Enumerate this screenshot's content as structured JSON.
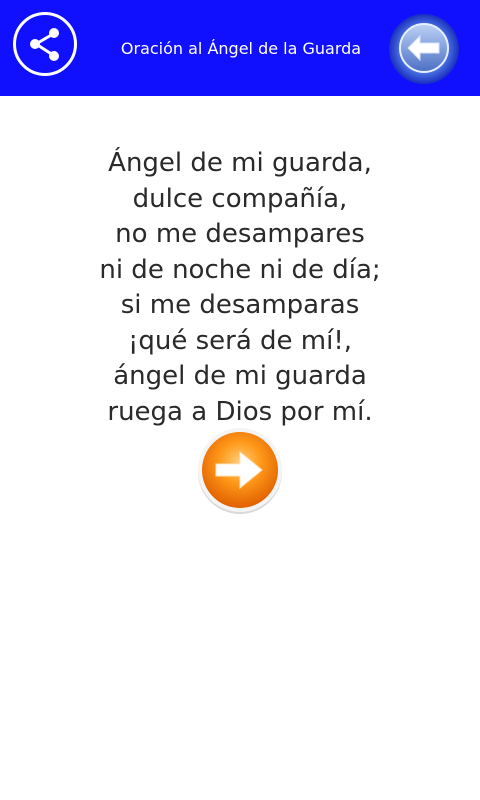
{
  "header": {
    "title": "Oración al Ángel de la Guarda",
    "background_color": "#1010ff",
    "share_icon": "share-icon",
    "back_icon": "arrow-left-icon"
  },
  "prayer": {
    "lines": [
      "Ángel de mi guarda,",
      "dulce compañía,",
      "no me desampares",
      "ni de noche ni de día;",
      "si me desamparas",
      "¡qué será de mí!,",
      "ángel de mi guarda",
      "ruega a Dios por mí."
    ]
  },
  "next_button": {
    "icon": "arrow-right-icon",
    "color": "#ff8c00"
  }
}
